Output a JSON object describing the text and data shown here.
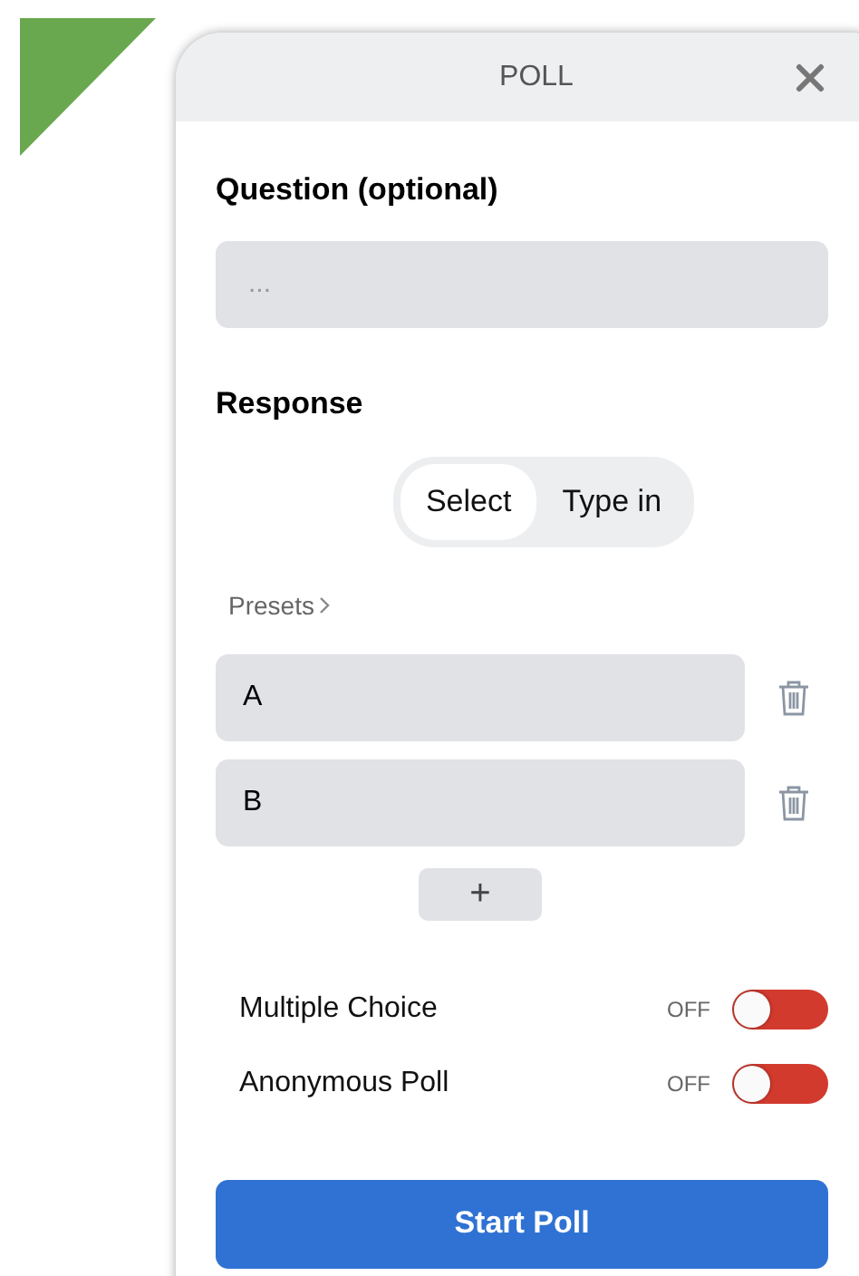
{
  "window": {
    "title": "POLL"
  },
  "question": {
    "label": "Question (optional)",
    "placeholder": "..."
  },
  "response": {
    "label": "Response",
    "modes": [
      {
        "label": "Select",
        "selected": true
      },
      {
        "label": "Type in",
        "selected": false
      }
    ]
  },
  "presets": {
    "label": "Presets"
  },
  "options": [
    {
      "value": "A"
    },
    {
      "value": "B"
    }
  ],
  "add_button": "+",
  "settings": [
    {
      "label": "Multiple Choice",
      "state_text": "OFF",
      "on": false
    },
    {
      "label": "Anonymous Poll",
      "state_text": "OFF",
      "on": false
    }
  ],
  "primary_button": "Start Poll"
}
